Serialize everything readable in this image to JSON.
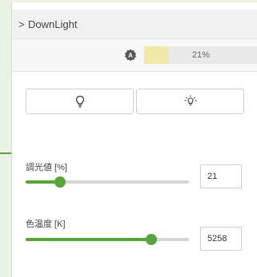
{
  "header": {
    "chevron": ">",
    "title": "DownLight"
  },
  "status": {
    "auto_icon": "auto-mode-icon",
    "level_text": "21%",
    "level_fraction": 0.21,
    "fill_color": "#f0e8a6"
  },
  "buttons": {
    "off_icon": "bulb-off-icon",
    "on_icon": "bulb-on-icon"
  },
  "brightness": {
    "label": "調光値 [%]",
    "value": "21",
    "fraction": 0.21
  },
  "color_temp": {
    "label": "色温度 [K]",
    "value": "5258",
    "fraction": 0.77
  },
  "accent": "#5aa33a"
}
